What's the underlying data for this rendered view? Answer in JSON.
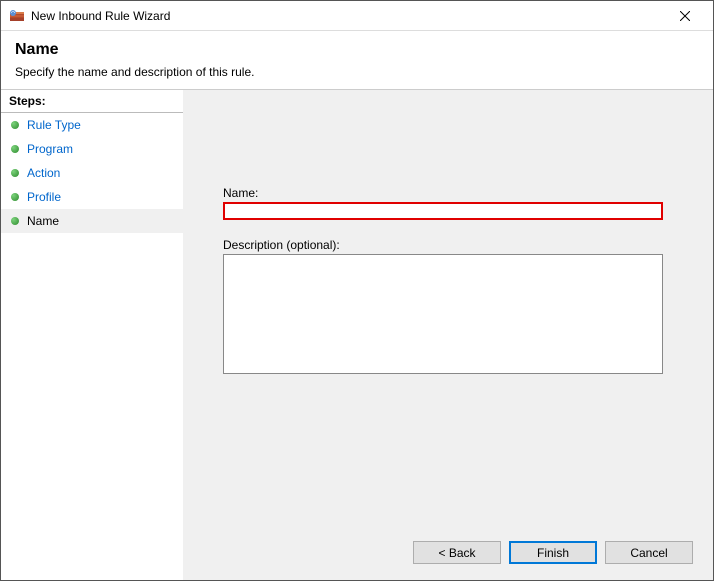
{
  "window": {
    "title": "New Inbound Rule Wizard"
  },
  "header": {
    "heading": "Name",
    "subheading": "Specify the name and description of this rule."
  },
  "sidebar": {
    "title": "Steps:",
    "items": [
      {
        "label": "Rule Type"
      },
      {
        "label": "Program"
      },
      {
        "label": "Action"
      },
      {
        "label": "Profile"
      },
      {
        "label": "Name"
      }
    ]
  },
  "form": {
    "name_label": "Name:",
    "name_value": "",
    "desc_label": "Description (optional):",
    "desc_value": ""
  },
  "buttons": {
    "back": "< Back",
    "finish": "Finish",
    "cancel": "Cancel"
  }
}
